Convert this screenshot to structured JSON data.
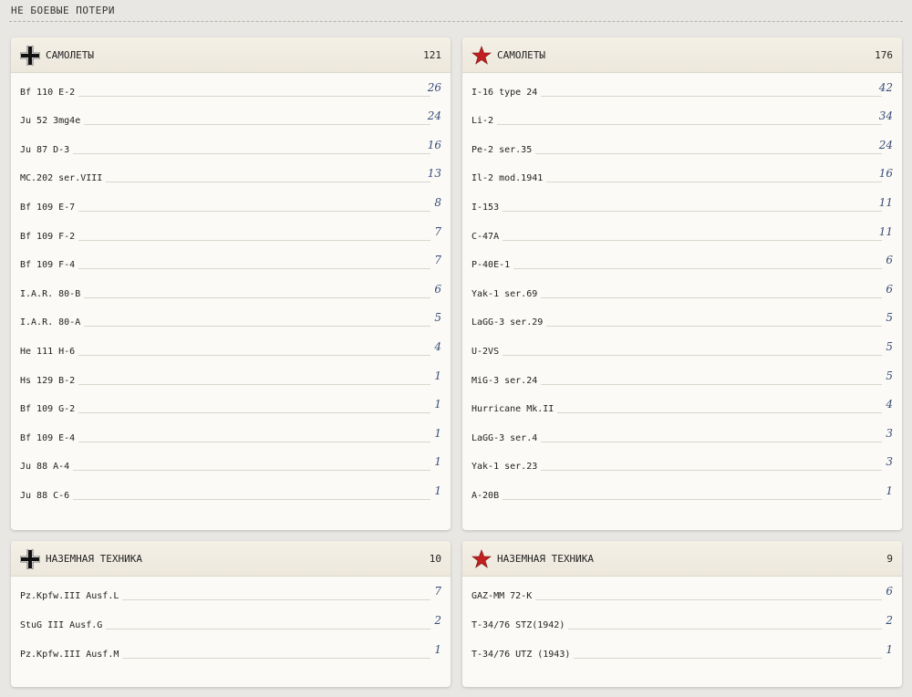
{
  "section_title": "НЕ БОЕВЫЕ ПОТЕРИ",
  "panels": {
    "axis_aircraft": {
      "title": "САМОЛЕТЫ",
      "count": "121",
      "icon": "balkenkreuz-icon",
      "rows": [
        {
          "label": "Bf 110 E-2",
          "value": "26"
        },
        {
          "label": "Ju 52 3mg4e",
          "value": "24"
        },
        {
          "label": "Ju 87 D-3",
          "value": "16"
        },
        {
          "label": "MC.202 ser.VIII",
          "value": "13"
        },
        {
          "label": "Bf 109 E-7",
          "value": "8"
        },
        {
          "label": "Bf 109 F-2",
          "value": "7"
        },
        {
          "label": "Bf 109 F-4",
          "value": "7"
        },
        {
          "label": "I.A.R. 80-B",
          "value": "6"
        },
        {
          "label": "I.A.R. 80-A",
          "value": "5"
        },
        {
          "label": "He 111 H-6",
          "value": "4"
        },
        {
          "label": "Hs 129 B-2",
          "value": "1"
        },
        {
          "label": "Bf 109 G-2",
          "value": "1"
        },
        {
          "label": "Bf 109 E-4",
          "value": "1"
        },
        {
          "label": "Ju 88 A-4",
          "value": "1"
        },
        {
          "label": "Ju 88 C-6",
          "value": "1"
        }
      ]
    },
    "soviet_aircraft": {
      "title": "САМОЛЕТЫ",
      "count": "176",
      "icon": "red-star-icon",
      "rows": [
        {
          "label": "I-16 type 24",
          "value": "42"
        },
        {
          "label": "Li-2",
          "value": "34"
        },
        {
          "label": "Pe-2 ser.35",
          "value": "24"
        },
        {
          "label": "Il-2 mod.1941",
          "value": "16"
        },
        {
          "label": "I-153",
          "value": "11"
        },
        {
          "label": "C-47A",
          "value": "11"
        },
        {
          "label": "P-40E-1",
          "value": "6"
        },
        {
          "label": "Yak-1 ser.69",
          "value": "6"
        },
        {
          "label": "LaGG-3 ser.29",
          "value": "5"
        },
        {
          "label": "U-2VS",
          "value": "5"
        },
        {
          "label": "MiG-3 ser.24",
          "value": "5"
        },
        {
          "label": "Hurricane Mk.II",
          "value": "4"
        },
        {
          "label": "LaGG-3 ser.4",
          "value": "3"
        },
        {
          "label": "Yak-1 ser.23",
          "value": "3"
        },
        {
          "label": "A-20B",
          "value": "1"
        }
      ]
    },
    "axis_ground": {
      "title": "НАЗЕМНАЯ ТЕХНИКА",
      "count": "10",
      "icon": "balkenkreuz-icon",
      "rows": [
        {
          "label": "Pz.Kpfw.III Ausf.L",
          "value": "7"
        },
        {
          "label": "StuG III Ausf.G",
          "value": "2"
        },
        {
          "label": "Pz.Kpfw.III Ausf.M",
          "value": "1"
        }
      ]
    },
    "soviet_ground": {
      "title": "НАЗЕМНАЯ ТЕХНИКА",
      "count": "9",
      "icon": "red-star-icon",
      "rows": [
        {
          "label": "GAZ-MM 72-K",
          "value": "6"
        },
        {
          "label": "T-34/76 STZ(1942)",
          "value": "2"
        },
        {
          "label": "T-34/76 UTZ (1943)",
          "value": "1"
        }
      ]
    }
  },
  "colors": {
    "star_red": "#c0201f",
    "cross_black": "#111111",
    "value_blue": "#3a4d78"
  }
}
